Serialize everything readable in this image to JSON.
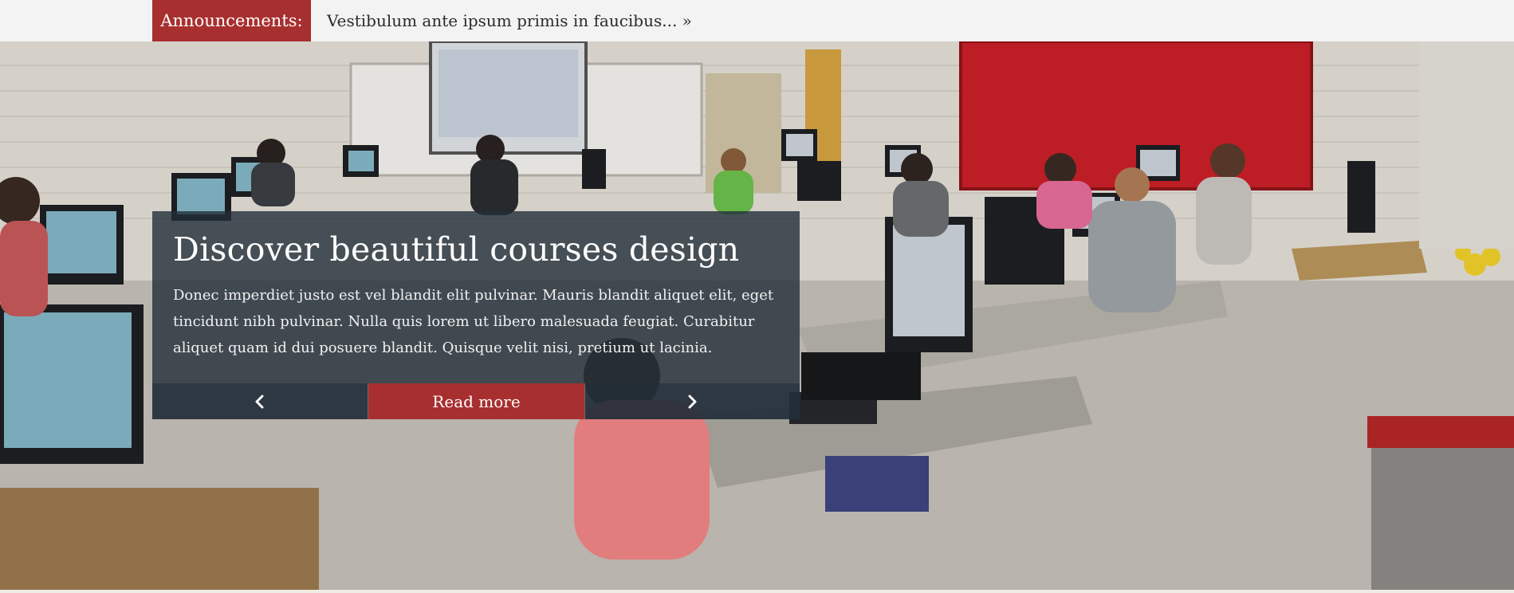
{
  "announcements": {
    "label": "Announcements:",
    "text": "Vestibulum ante ipsum primis in faucibus... »"
  },
  "hero": {
    "image_description": "Computer lab classroom with students at desktop computers",
    "caption": {
      "title": "Discover beautiful courses design",
      "text": "Donec imperdiet justo est vel blandit elit pulvinar. Mauris blandit aliquet elit, eget tincidunt nibh pulvinar. Nulla quis lorem ut libero malesuada feugiat. Curabitur aliquet quam id dui posuere blandit. Quisque velit nisi, pretium ut lacinia."
    },
    "controls": {
      "prev_icon": "chevron-left-icon",
      "read_more_label": "Read more",
      "next_icon": "chevron-right-icon"
    }
  },
  "colors": {
    "accent": "#a82f2f",
    "caption_bg": "#222e38",
    "announce_bg": "#f3f3f3"
  }
}
